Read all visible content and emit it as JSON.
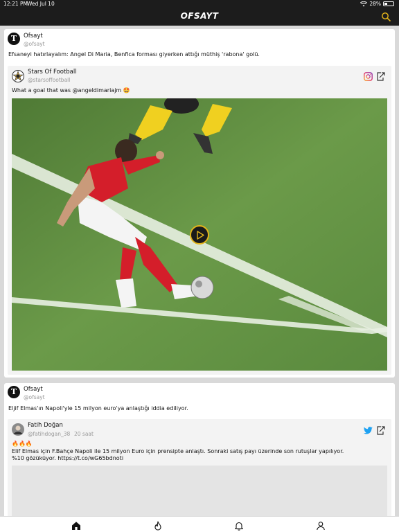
{
  "status_bar": {
    "time": "12:21 PM",
    "date": "Wed Jul 10",
    "battery": "28%"
  },
  "app": {
    "logo": "OFSAYT",
    "accent_color": "#e2b31a"
  },
  "posts": [
    {
      "author": "Ofsayt",
      "handle": "@ofsayt",
      "avatar_letter": "T",
      "text": "Efsaneyi hatırlayalım: Angel Di Maria, Benfica forması giyerken attığı müthiş 'rabona' golü.",
      "embed": {
        "source": "instagram",
        "author": "Stars Of Football",
        "handle": "@starsoffootball",
        "text": "What a goal that was @angeldimariajm 🤩",
        "media": "video"
      }
    },
    {
      "author": "Ofsayt",
      "handle": "@ofsayt",
      "avatar_letter": "T",
      "text": "Eljif Elmas'ın Napoli'yle 15 milyon euro'ya anlaştığı iddia ediliyor.",
      "embed": {
        "source": "twitter",
        "author": "Fatih Doğan",
        "handle": "@fatihdogan_38",
        "time": "20 saat",
        "emoji": "🔥🔥🔥",
        "text_line1": "Elif Elmas için F.Bahçe Napoli ile 15 milyon Euro için prensipte anlaştı. Sonraki satış payı üzerinde son rutuşlar yapılıyor.",
        "text_line2": "%10 gözüküyor. https://t.co/wG65bdnoti"
      }
    }
  ],
  "tabbar": {
    "items": [
      {
        "icon": "home-icon",
        "active": true
      },
      {
        "icon": "flame-icon",
        "active": false
      },
      {
        "icon": "bell-icon",
        "active": false
      },
      {
        "icon": "profile-icon",
        "active": false
      }
    ]
  }
}
